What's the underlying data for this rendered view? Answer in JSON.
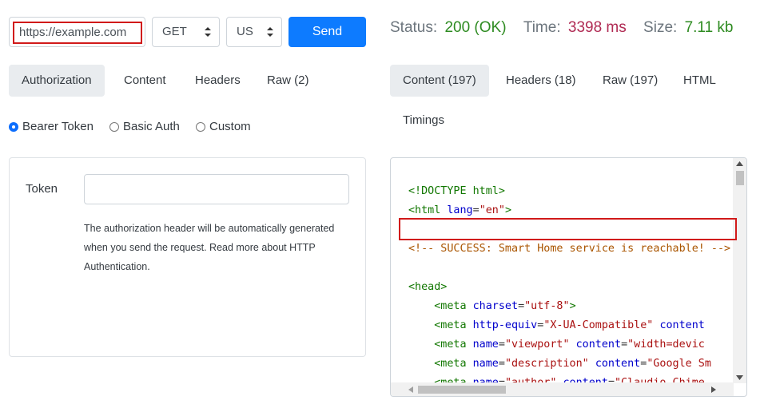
{
  "request": {
    "url": "https://example.com",
    "method": "GET",
    "region": "US",
    "send_label": "Send"
  },
  "status": {
    "status_label": "Status:",
    "status_value": "200 (OK)",
    "time_label": "Time:",
    "time_value": "3398 ms",
    "size_label": "Size:",
    "size_value": "7.11 kb"
  },
  "request_tabs": [
    {
      "label": "Authorization",
      "active": true
    },
    {
      "label": "Content",
      "active": false
    },
    {
      "label": "Headers",
      "active": false
    },
    {
      "label": "Raw (2)",
      "active": false
    }
  ],
  "response_tabs": [
    {
      "label": "Content (197)",
      "active": true
    },
    {
      "label": "Headers (18)",
      "active": false
    },
    {
      "label": "Raw (197)",
      "active": false
    },
    {
      "label": "HTML",
      "active": false
    },
    {
      "label": "Timings",
      "active": false
    }
  ],
  "auth": {
    "options": [
      {
        "label": "Bearer Token",
        "checked": true
      },
      {
        "label": "Basic Auth",
        "checked": false
      },
      {
        "label": "Custom",
        "checked": false
      }
    ],
    "token_label": "Token",
    "token_value": "",
    "help_lines": [
      "The authorization header will be automatically generated",
      "when you send the request. Read more about HTTP",
      "Authentication."
    ]
  },
  "colors": {
    "accent": "#0d7bff",
    "status_green": "#2e8b21",
    "time_maroon": "#b02a53",
    "highlight_red": "#d11a1a"
  }
}
